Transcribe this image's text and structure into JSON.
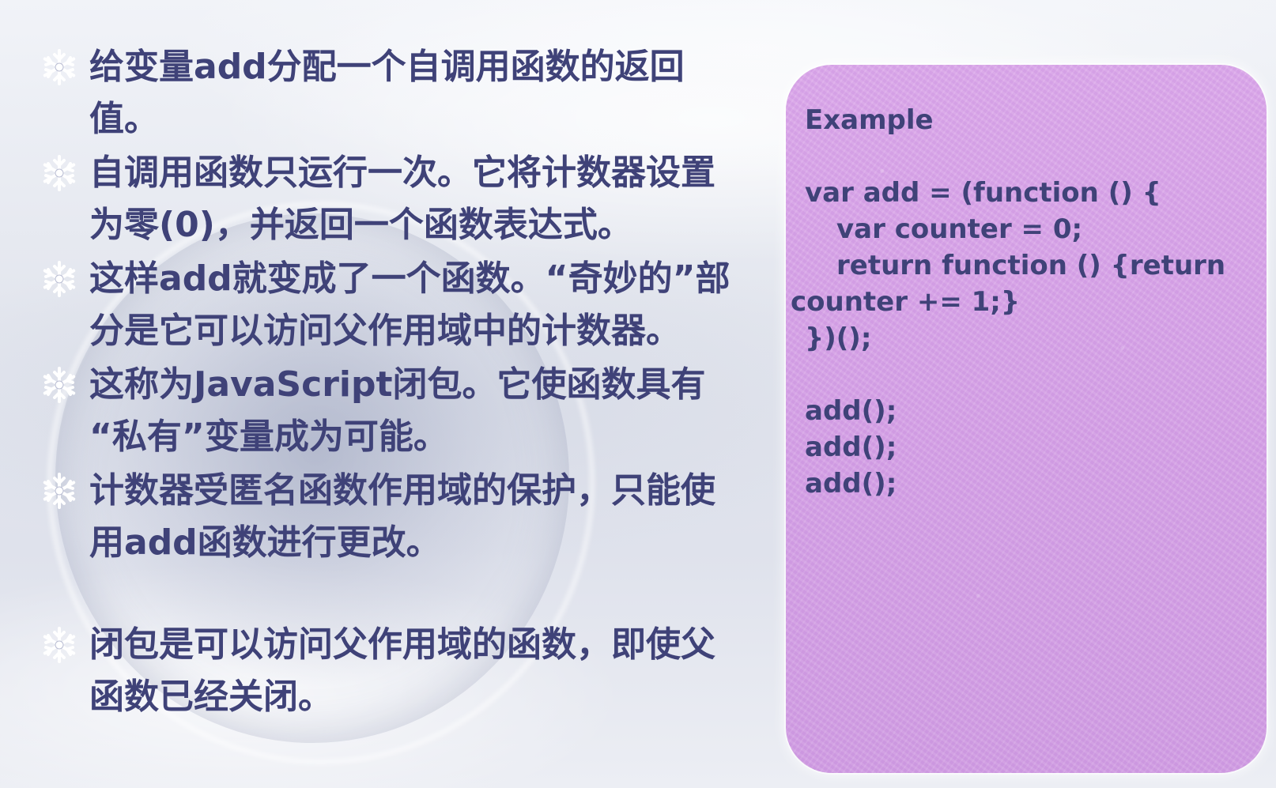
{
  "bullets": [
    {
      "lines": [
        "给变量add分配一个自调用函数的返回",
        "值。"
      ]
    },
    {
      "lines": [
        "自调用函数只运行一次。它将计数器设置",
        "为零(0)，并返回一个函数表达式。"
      ]
    },
    {
      "lines": [
        "这样add就变成了一个函数。“奇妙的”部",
        "分是它可以访问父作用域中的计数器。"
      ]
    },
    {
      "lines": [
        "这称为JavaScript闭包。它使函数具有",
        "“私有”变量成为可能。"
      ]
    },
    {
      "lines": [
        "计数器受匿名函数作用域的保护，只能使",
        "用add函数进行更改。"
      ]
    },
    {
      "lines": [
        "闭包是可以访问父作用域的函数，即使父",
        "函数已经关闭。"
      ]
    }
  ],
  "code_box": {
    "title": "Example",
    "lines": [
      "var add = (function () {",
      "var counter = 0;",
      "return function () {return",
      "counter += 1;}",
      "})();",
      "add();",
      "add();",
      "add();"
    ]
  },
  "colors": {
    "text": "#3f4278",
    "code_box_bg": "#d6a3e6",
    "bullet_icon": "#ffffff"
  },
  "icons": {
    "bullet": "snowflake-icon"
  }
}
